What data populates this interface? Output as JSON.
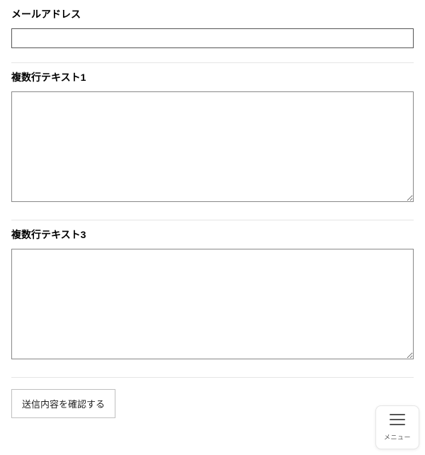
{
  "form": {
    "fields": [
      {
        "label": "メールアドレス",
        "type": "text",
        "value": ""
      },
      {
        "label": "複数行テキスト1",
        "type": "textarea",
        "value": ""
      },
      {
        "label": "複数行テキスト3",
        "type": "textarea",
        "value": ""
      }
    ],
    "submit_label": "送信内容を確認する"
  },
  "menu": {
    "label": "メニュー"
  }
}
